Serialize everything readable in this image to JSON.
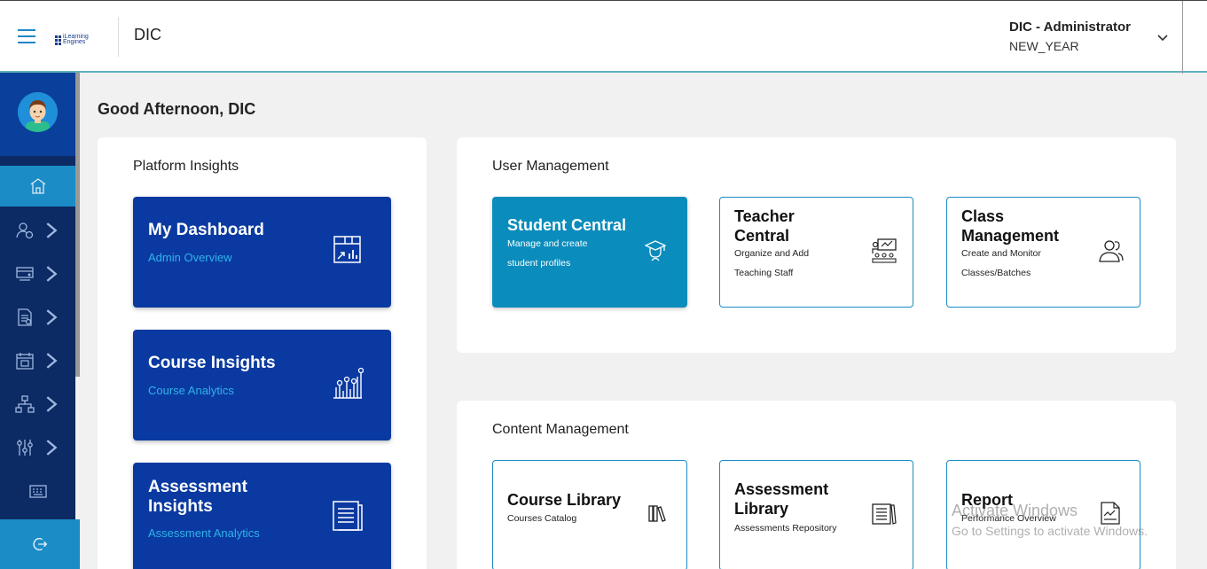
{
  "header": {
    "logo_text": "iLearning Engines",
    "app_title": "DIC",
    "user_name": "DIC - Administrator",
    "user_role": "NEW_YEAR"
  },
  "greeting": "Good Afternoon, DIC",
  "sidebar": {
    "items": [
      {
        "icon": "home-icon",
        "active": true
      },
      {
        "icon": "users-icon"
      },
      {
        "icon": "courses-icon"
      },
      {
        "icon": "documents-icon"
      },
      {
        "icon": "calendar-icon"
      },
      {
        "icon": "hierarchy-icon"
      },
      {
        "icon": "settings-sliders-icon"
      },
      {
        "icon": "keyboard-icon"
      },
      {
        "icon": "logout-icon"
      }
    ]
  },
  "platform_insights": {
    "title": "Platform Insights",
    "cards": [
      {
        "title": "My Dashboard",
        "subtitle": "Admin Overview",
        "icon": "dashboard-chart-icon"
      },
      {
        "title": "Course Insights",
        "subtitle": "Course Analytics",
        "icon": "analytics-bars-icon"
      },
      {
        "title": "Assessment Insights",
        "subtitle": "Assessment Analytics",
        "icon": "document-list-icon"
      }
    ]
  },
  "user_management": {
    "title": "User Management",
    "cards": [
      {
        "title": "Student Central",
        "subtitle": "Manage and create student profiles",
        "icon": "graduation-cap-icon"
      },
      {
        "title": "Teacher Central",
        "subtitle": "Organize and Add Teaching Staff",
        "icon": "classroom-icon"
      },
      {
        "title": "Class Management",
        "subtitle": "Create and Monitor Classes/Batches",
        "icon": "group-users-icon"
      }
    ]
  },
  "content_management": {
    "title": "Content Management",
    "cards": [
      {
        "title": "Course Library",
        "subtitle": "Courses Catalog",
        "icon": "books-icon"
      },
      {
        "title": "Assessment Library",
        "subtitle": "Assessments Repository",
        "icon": "binder-icon"
      },
      {
        "title": "Report",
        "subtitle": "Performance Overview",
        "icon": "report-chart-icon"
      }
    ]
  },
  "watermark": {
    "line1": "Activate Windows",
    "line2": "Go to Settings to activate Windows."
  },
  "colors": {
    "brand_dark": "#0c2a63",
    "brand_blue": "#0a3aa1",
    "accent_teal": "#0a8cbc",
    "accent_light": "#2fb3ea"
  }
}
